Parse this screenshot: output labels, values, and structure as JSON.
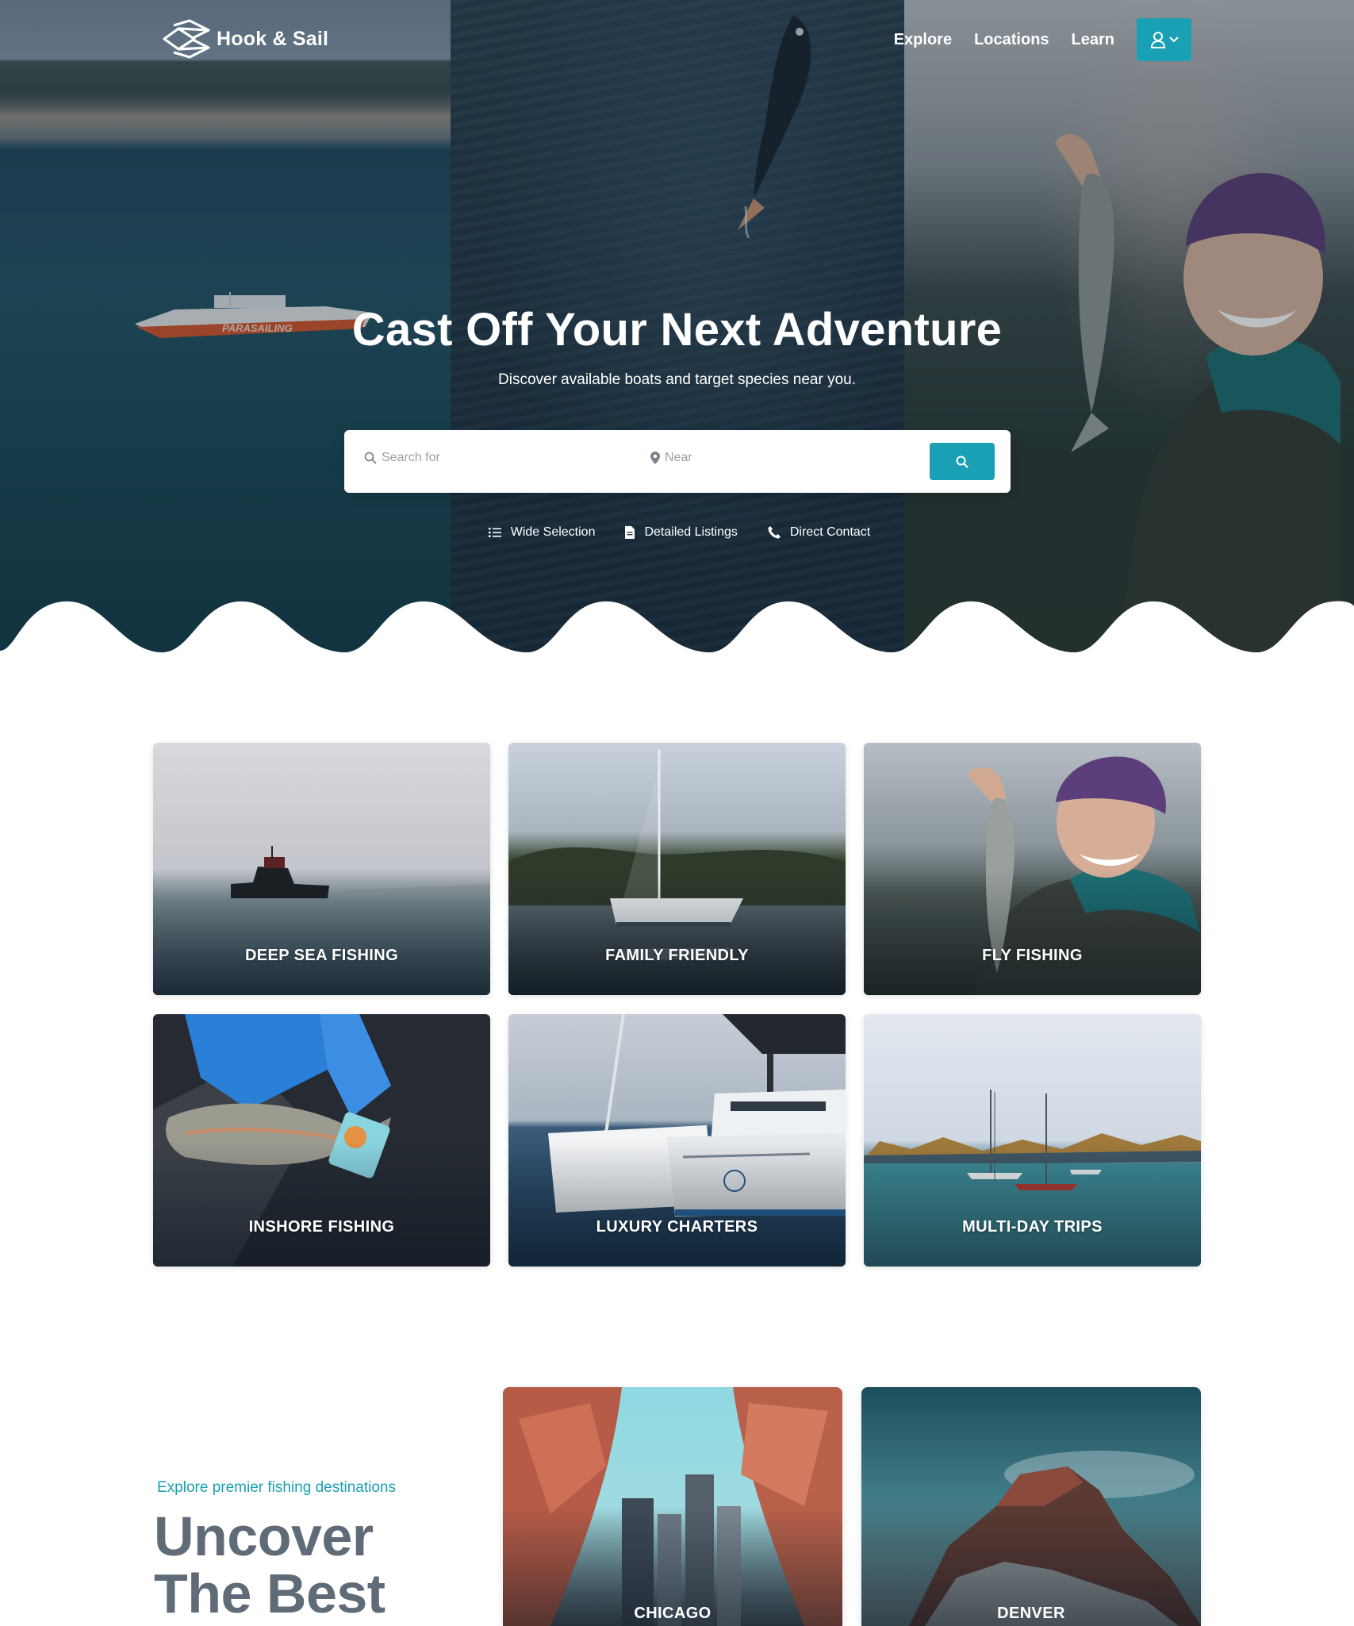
{
  "brand": {
    "name": "Hook & Sail",
    "accent": "#1aa0b4",
    "title_gray": "#5f6b76"
  },
  "nav": {
    "links": [
      "Explore",
      "Locations",
      "Learn"
    ],
    "user_icon": "user-icon",
    "dropdown_icon": "chevron-down-icon"
  },
  "hero": {
    "title": "Cast Off Your Next Adventure",
    "subtitle": "Discover available boats and target species near you.",
    "boat_text": "PARASAILING",
    "search": {
      "what_placeholder": "Search for",
      "where_placeholder": "Near",
      "button_icon": "search-icon"
    },
    "features": [
      {
        "icon": "list-icon",
        "label": "Wide Selection"
      },
      {
        "icon": "document-icon",
        "label": "Detailed Listings"
      },
      {
        "icon": "phone-icon",
        "label": "Direct Contact"
      }
    ]
  },
  "categories": [
    {
      "label": "DEEP SEA FISHING"
    },
    {
      "label": "FAMILY FRIENDLY"
    },
    {
      "label": "FLY FISHING"
    },
    {
      "label": "INSHORE FISHING"
    },
    {
      "label": "LUXURY CHARTERS"
    },
    {
      "label": "MULTI-DAY TRIPS"
    }
  ],
  "destinations": {
    "eyebrow": "Explore premier fishing destinations",
    "title_line1": "Uncover",
    "title_line2": "The Best",
    "cards": [
      {
        "label": "CHICAGO"
      },
      {
        "label": "DENVER"
      }
    ]
  }
}
